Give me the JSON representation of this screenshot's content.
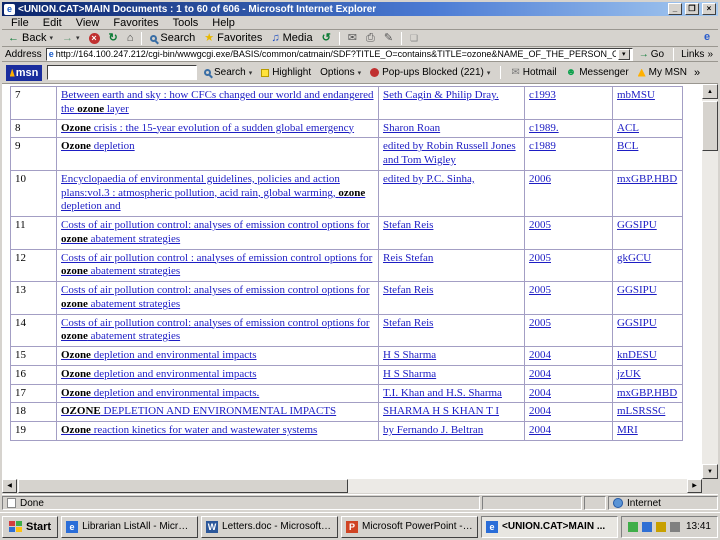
{
  "window": {
    "title": "<UNION.CAT>MAIN Documents : 1 to 60 of 606 - Microsoft Internet Explorer",
    "controls": {
      "minimize": "_",
      "restore": "❐",
      "close": "×"
    }
  },
  "icons": {
    "ie": "e",
    "back": "←",
    "forward": "→",
    "stop": "×",
    "refresh": "↻",
    "home": "⌂",
    "favorites": "★",
    "media": "♫",
    "history": "↺",
    "mail": "✉",
    "print": "⎙",
    "edit": "✎",
    "discuss": "❏",
    "dropdown": "▾",
    "chevron": "»",
    "go": "→",
    "up": "▲",
    "down": "▼",
    "left": "◀",
    "right": "▶",
    "messenger": "☻"
  },
  "menubar": {
    "items": [
      "File",
      "Edit",
      "View",
      "Favorites",
      "Tools",
      "Help"
    ]
  },
  "toolbar": {
    "back_label": "Back",
    "search_label": "Search",
    "favorites_label": "Favorites",
    "media_label": "Media"
  },
  "addressbar": {
    "label": "Address",
    "url": "http://164.100.247.212/cgi-bin/wwwgcgi.exe/BASIS/common/catmain/SDF?TITLE_O=contains&TITLE=ozone&NAME_OF_THE_PERSON_O=contains&NAME_OF_THE_PERSO",
    "go_label": "Go",
    "links_label": "Links"
  },
  "msnbar": {
    "logo": "msn",
    "search_value": "",
    "search_label": "Search",
    "highlight_label": "Highlight",
    "options_label": "Options",
    "popups_label": "Pop-ups Blocked (221)",
    "hotmail_label": "Hotmail",
    "messenger_label": "Messenger",
    "mymsn_label": "My MSN"
  },
  "results": {
    "highlight_term": "ozone",
    "rows": [
      {
        "num": "7",
        "title": "Between earth and sky : how CFCs changed our world and endangered the ozone layer",
        "author": "Seth Cagin & Philip Dray.",
        "year": "c1993",
        "code": "mbMSU"
      },
      {
        "num": "8",
        "title": "Ozone crisis : the 15-year evolution of a sudden global emergency",
        "author": "Sharon Roan",
        "year": "c1989.",
        "code": "ACL"
      },
      {
        "num": "9",
        "title": "Ozone depletion",
        "author": "edited by Robin Russell Jones and Tom Wigley",
        "year": "c1989",
        "code": "BCL"
      },
      {
        "num": "10",
        "title": "Encyclopaedia of environmental guidelines, policies and action plans:vol.3 : atmospheric pollution, acid rain, global warming, ozone depletion and",
        "author": "edited by P.C. Sinha,",
        "year": "2006",
        "code": "mxGBP.HBD"
      },
      {
        "num": "11",
        "title": "Costs of air pollution control: analyses of emission control options for ozone abatement strategies",
        "author": "Stefan Reis",
        "year": "2005",
        "code": "GGSIPU"
      },
      {
        "num": "12",
        "title": "Costs of air pollution control : analyses of emission control options for ozone abatement strategies",
        "author": "Reis Stefan",
        "year": "2005",
        "code": "gkGCU"
      },
      {
        "num": "13",
        "title": "Costs of air pollution control: analyses of emission control options for ozone abatement strategies",
        "author": "Stefan Reis",
        "year": "2005",
        "code": "GGSIPU"
      },
      {
        "num": "14",
        "title": "Costs of air pollution control: analyses of emission control options for ozone abatement strategies",
        "author": "Stefan Reis",
        "year": "2005",
        "code": "GGSIPU"
      },
      {
        "num": "15",
        "title": "Ozone depletion and environmental impacts",
        "author": "H S Sharma",
        "year": "2004",
        "code": "knDESU"
      },
      {
        "num": "16",
        "title": "Ozone depletion and environmental impacts",
        "author": "H S Sharma",
        "year": "2004",
        "code": "jzUK"
      },
      {
        "num": "17",
        "title": "Ozone depletion and environmental impacts.",
        "author": "T.I. Khan and H.S. Sharma",
        "year": "2004",
        "code": "mxGBP.HBD"
      },
      {
        "num": "18",
        "title": "OZONE DEPLETION AND ENVIRONMENTAL IMPACTS",
        "author": "SHARMA H S KHAN T I",
        "year": "2004",
        "code": "mLSRSSC"
      },
      {
        "num": "19",
        "title": "Ozone reaction kinetics for water and wastewater systems",
        "author": "by Fernando J. Beltran",
        "year": "2004",
        "code": "MRI"
      }
    ]
  },
  "statusbar": {
    "status": "Done",
    "zone": "Internet"
  },
  "taskbar": {
    "start_label": "Start",
    "tasks": [
      {
        "label": "Librarian ListAll - Microsof...",
        "icon": "e",
        "icon_color": "#2a6dd8",
        "active": false
      },
      {
        "label": "Letters.doc - Microsoft Word",
        "icon": "W",
        "icon_color": "#2b579a",
        "active": false
      },
      {
        "label": "Microsoft PowerPoint - [U...",
        "icon": "P",
        "icon_color": "#d04423",
        "active": false
      },
      {
        "label": "<UNION.CAT>MAIN ...",
        "icon": "e",
        "icon_color": "#2a6dd8",
        "active": true
      }
    ],
    "tray_icon_colors": [
      "#3fae49",
      "#2f6fd4",
      "#c8a000",
      "#808080"
    ],
    "clock": "13:41"
  }
}
